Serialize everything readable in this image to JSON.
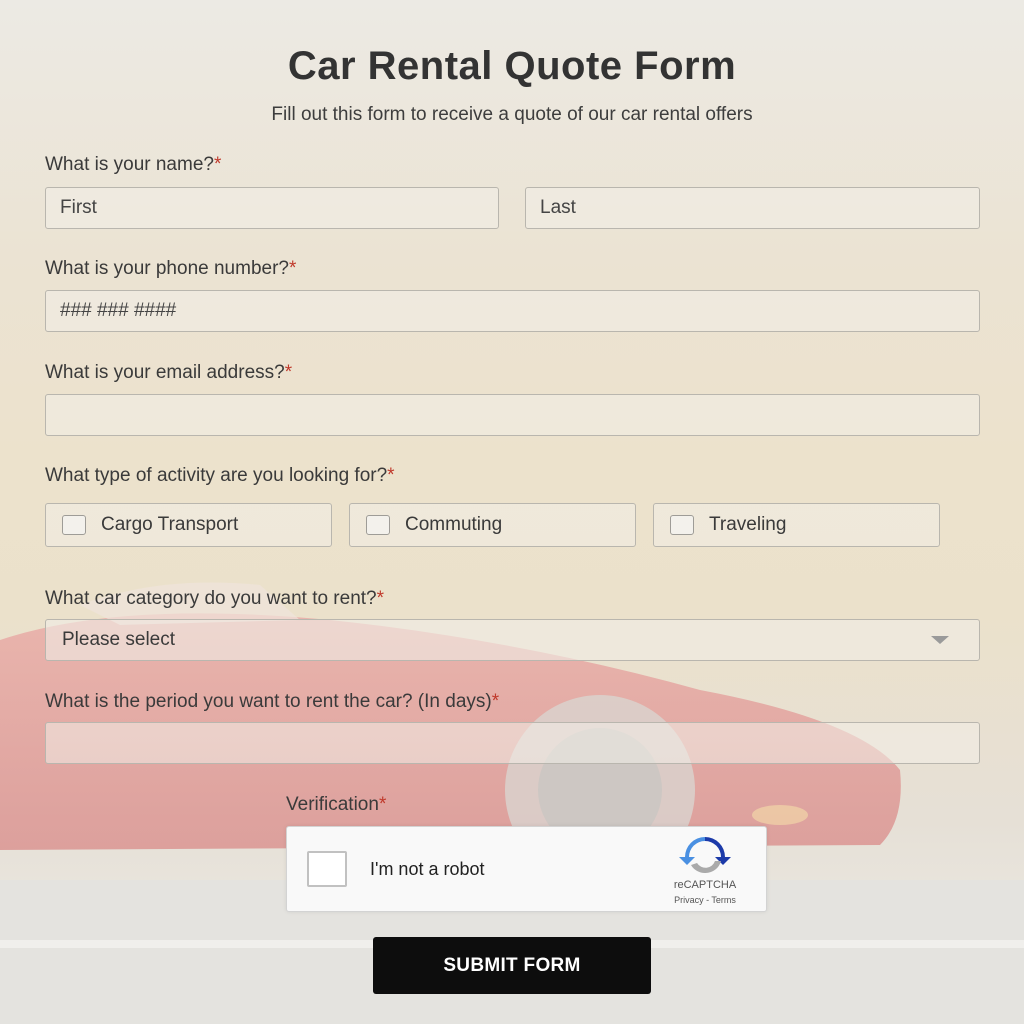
{
  "form": {
    "title": "Car Rental Quote Form",
    "subtitle": "Fill out this form to receive a quote of our car rental offers",
    "required_mark": "*"
  },
  "name_question": {
    "label": "What is your name?",
    "first_placeholder": "First",
    "last_placeholder": "Last"
  },
  "phone_question": {
    "label": "What is your phone number?",
    "placeholder": "### ### ####"
  },
  "email_question": {
    "label": "What is your email address?",
    "value": ""
  },
  "activity_question": {
    "label": "What type of activity are you looking for?",
    "options": [
      {
        "label": "Cargo Transport",
        "checked": false
      },
      {
        "label": "Commuting",
        "checked": false
      },
      {
        "label": "Traveling",
        "checked": false
      }
    ]
  },
  "category_question": {
    "label": "What car category do you want to rent?",
    "selected": "Please select"
  },
  "period_question": {
    "label": "What is the period you want to rent the car? (In days)",
    "value": ""
  },
  "verification": {
    "label": "Verification",
    "checkbox_text": "I'm not a robot",
    "brand": "reCAPTCHA",
    "links": "Privacy - Terms"
  },
  "submit_label": "SUBMIT FORM",
  "colors": {
    "required": "#c0392b",
    "submit_bg": "#0d0d0d",
    "car_red": "#c81e23"
  }
}
